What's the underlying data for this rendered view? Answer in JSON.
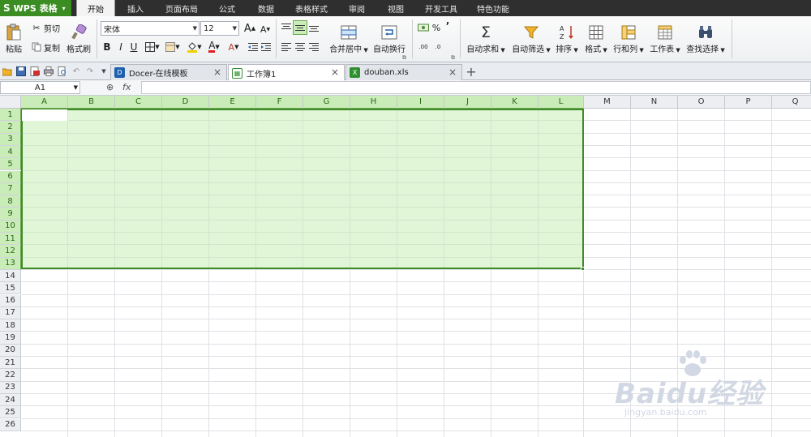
{
  "app": {
    "logo": "S",
    "name": "WPS 表格",
    "menu_caret": "▾"
  },
  "menu_tabs": [
    "开始",
    "插入",
    "页面布局",
    "公式",
    "数据",
    "表格样式",
    "审阅",
    "视图",
    "开发工具",
    "特色功能"
  ],
  "active_menu_tab": "开始",
  "ribbon": {
    "paste": "粘贴",
    "cut": "剪切",
    "copy": "复制",
    "format_painter": "格式刷",
    "font_name": "宋体",
    "font_size": "12",
    "bold": "B",
    "italic": "I",
    "underline": "U",
    "grow_font": "A",
    "shrink_font": "A",
    "merge_center": "合并居中",
    "wrap_text": "自动换行",
    "percent": "%",
    "comma": "’",
    "inc_decimal": "⁺⁰⁄₀₀",
    "dec_decimal": "⁰⁰⁄₊₀",
    "autosum": "自动求和",
    "autofilter": "自动筛选",
    "sort": "排序",
    "format": "格式",
    "rows_cols": "行和列",
    "worksheet": "工作表",
    "find_select": "查找选择",
    "sigma": "Σ"
  },
  "doc_tabs": [
    {
      "name": "Docer-在线模板",
      "icon": "D",
      "icon_color": "#1e5fb0",
      "active": false
    },
    {
      "name": "工作簿1",
      "icon": "▦",
      "icon_color": "#2f8f2f",
      "active": true
    },
    {
      "name": "douban.xls",
      "icon": "X",
      "icon_color": "#2f8f2f",
      "active": false
    }
  ],
  "formula_bar": {
    "name_box": "A1",
    "fx": "fx",
    "zoom_icon": "⊕",
    "formula": ""
  },
  "columns": [
    "A",
    "B",
    "C",
    "D",
    "E",
    "F",
    "G",
    "H",
    "I",
    "J",
    "K",
    "L",
    "M",
    "N",
    "O",
    "P",
    "Q"
  ],
  "rows": [
    "1",
    "2",
    "3",
    "4",
    "5",
    "6",
    "7",
    "8",
    "9",
    "10",
    "11",
    "12",
    "13",
    "14",
    "15",
    "16",
    "17",
    "18",
    "19",
    "20",
    "21",
    "22",
    "23",
    "24",
    "25",
    "26"
  ],
  "selection": {
    "range": "A1:L13",
    "active_cell": "A1",
    "accent": "#3e8c28"
  },
  "watermark": {
    "brand": "Baidu经验",
    "url": "jingyan.baidu.com"
  },
  "colors": {
    "app_green": "#3b8c22",
    "menubar_bg": "#2f2f2f",
    "selection_fill": "#c4eeb0"
  }
}
